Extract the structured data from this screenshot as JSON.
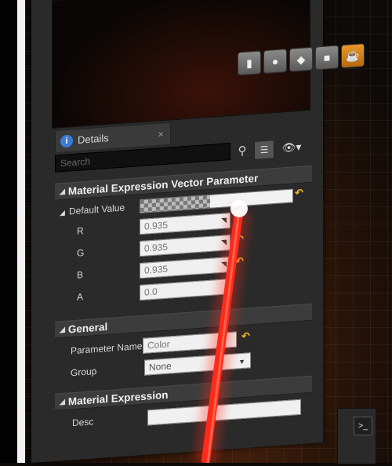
{
  "details_tab": {
    "info_icon": "info-icon",
    "title": "Details",
    "close_glyph": "×"
  },
  "toolbar": {
    "search_placeholder": "Search",
    "search_icon": "search-icon",
    "grid_icon": "grid-view-icon",
    "eye_icon": "eye-icon"
  },
  "preview_shapes": [
    "cylinder-icon",
    "sphere-icon",
    "plane-icon",
    "cube-icon",
    "teapot-icon"
  ],
  "sections": {
    "vector_param": {
      "title": "Material Expression Vector Parameter",
      "default_value_label": "Default Value",
      "channels": [
        {
          "label": "R",
          "value": "0.935"
        },
        {
          "label": "G",
          "value": "0.935"
        },
        {
          "label": "B",
          "value": "0.935"
        },
        {
          "label": "A",
          "value": "0.0"
        }
      ]
    },
    "general": {
      "title": "General",
      "parameter_name_label": "Parameter Name",
      "parameter_name_value": "Color",
      "group_label": "Group",
      "group_value": "None"
    },
    "material_expression": {
      "title": "Material Expression",
      "desc_label": "Desc",
      "desc_value": ""
    }
  },
  "colors": {
    "reset_arrow": "#e8b020",
    "laser": "#ff2a1a",
    "active_shape": "#d8801a"
  }
}
